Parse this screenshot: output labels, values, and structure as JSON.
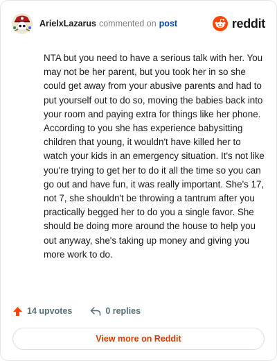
{
  "header": {
    "username": "ArielxLazarus",
    "action_text": "commented on",
    "post_link": "post",
    "brand": "reddit",
    "avatar_icon": "pirate-skull-avatar-icon",
    "brand_icon": "reddit-snoo-icon"
  },
  "comment": {
    "text": "NTA but you need to have a serious talk with her. You may not be her parent, but you took her in so she could get away from your abusive parents and had to put yourself out to do so, moving the babies back into your room and paying extra for things like her phone. According to you she has experience babysitting children that young, it wouldn't have killed her to watch your kids in an emergency situation. It's not like you're trying to get her to do it all the time so you can go out and have fun, it was really important. She's 17, not 7, she shouldn't be throwing a tantrum after you practically begged her to do you a single favor. She should be doing more around the house to help you out anyway, she's taking up money and giving you more work to do."
  },
  "stats": {
    "upvotes": "14 upvotes",
    "replies": "0 replies",
    "upvote_icon": "upvote-arrow-icon",
    "reply_icon": "reply-arrow-icon"
  },
  "footer": {
    "view_more_label": "View more on Reddit"
  },
  "colors": {
    "brand_orange": "#ff4500",
    "link_blue": "#0045ac",
    "view_more_text": "#d93a00",
    "muted": "#576f76"
  }
}
